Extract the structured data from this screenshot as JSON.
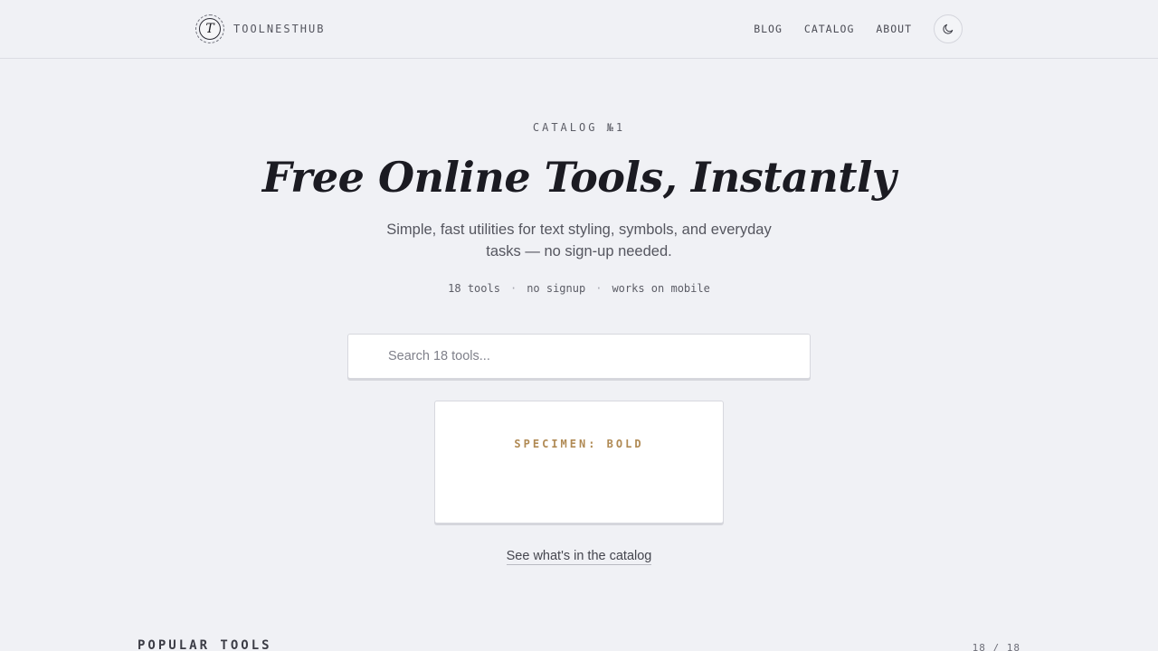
{
  "header": {
    "brand_initial": "T",
    "brand_name": "TOOLNESTHUB",
    "nav": [
      "BLOG",
      "CATALOG",
      "ABOUT"
    ],
    "theme_toggle_icon": "moon-icon"
  },
  "hero": {
    "eyebrow": "CATALOG №1",
    "title": "Free Online Tools, Instantly",
    "subtitle": "Simple, fast utilities for text styling, symbols, and everyday tasks — no sign-up needed.",
    "meta": [
      "18 tools",
      "no signup",
      "works on mobile"
    ]
  },
  "search": {
    "placeholder": "Search 18 tools...",
    "value": ""
  },
  "specimen": {
    "label": "SPECIMEN: BOLD"
  },
  "catalog_link": "See what's in the catalog",
  "popular": {
    "title": "POPULAR TOOLS",
    "count": "18 / 18"
  },
  "colors": {
    "background": "#f0f1f5",
    "accent": "#b08a54",
    "text": "#1c1c22"
  }
}
